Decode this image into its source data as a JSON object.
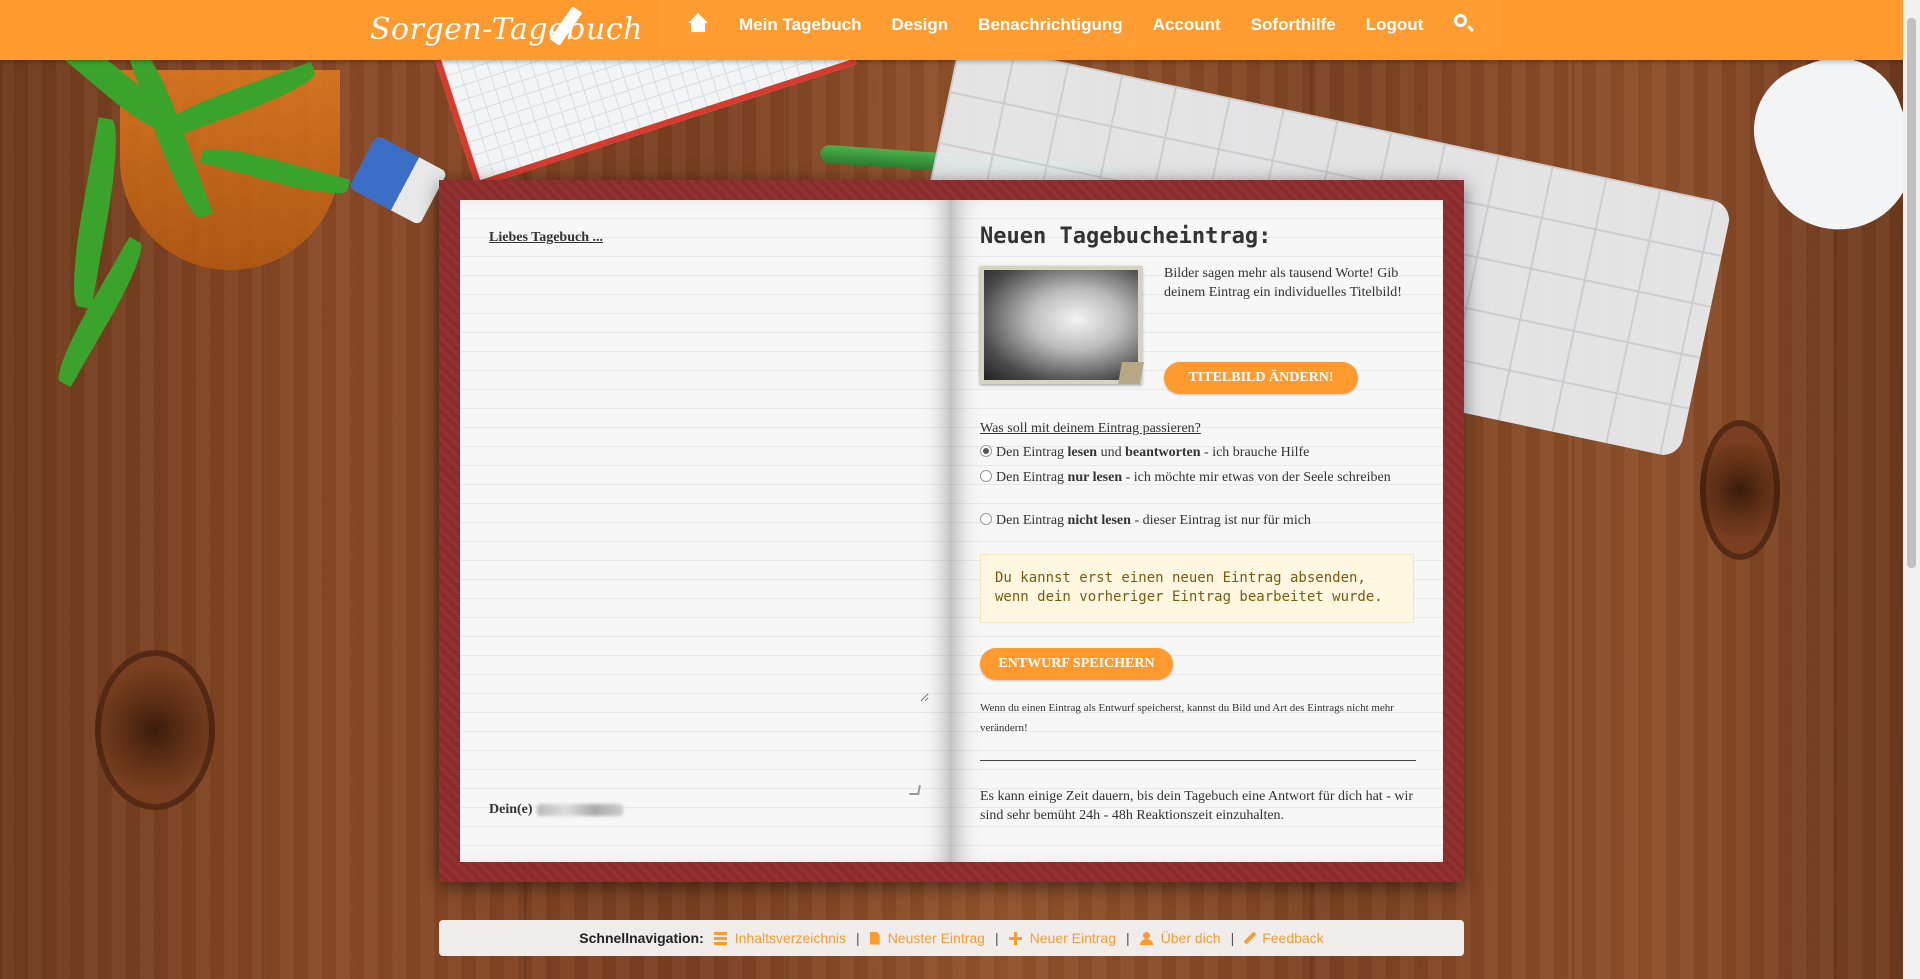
{
  "header": {
    "logo": "Sorgen-Tagebuch",
    "nav": {
      "home_icon": "home-icon",
      "items": [
        "Mein Tagebuch",
        "Design",
        "Benachrichtigung",
        "Account",
        "Soforthilfe",
        "Logout"
      ],
      "search_icon": "search-icon"
    }
  },
  "left_page": {
    "greeting": "Liebes Tagebuch ...",
    "textarea_value": "",
    "signature_prefix": "Dein(e)"
  },
  "right_page": {
    "title": "Neuen Tagebucheintrag:",
    "image_text": "Bilder sagen mehr als tausend Worte! Gib deinem Eintrag ein individuelles Titelbild!",
    "cover_button": "TITELBILD ÄNDERN!",
    "question": "Was soll mit deinem Eintrag passieren?",
    "options": [
      {
        "pre": "Den Eintrag ",
        "b1": "lesen",
        "mid": " und ",
        "b2": "beantworten",
        "post": " - ich brauche Hilfe",
        "checked": true
      },
      {
        "pre": "Den Eintrag ",
        "b1": "nur lesen",
        "post": " - ich möchte mir etwas von der Seele schreiben",
        "checked": false
      },
      {
        "pre": "Den Eintrag ",
        "b1": "nicht lesen",
        "post": " - dieser Eintrag ist nur für mich",
        "checked": false
      }
    ],
    "notice": "Du kannst erst einen neuen Eintrag absenden, wenn dein vorheriger Eintrag bearbeitet wurde.",
    "draft_button": "ENTWURF SPEICHERN",
    "draft_note": "Wenn du einen Eintrag als Entwurf speicherst, kannst du Bild und Art des Eintrags nicht mehr verändern!",
    "wait_note": "Es kann einige Zeit dauern, bis dein Tagebuch eine Antwort für dich hat - wir sind sehr bemüht 24h - 48h Reaktionszeit einzuhalten."
  },
  "quicknav": {
    "label": "Schnellnavigation:",
    "links": [
      {
        "label": "Inhaltsverzeichnis",
        "icon": "list-icon"
      },
      {
        "label": "Neuster Eintrag",
        "icon": "file-icon"
      },
      {
        "label": "Neuer Eintrag",
        "icon": "plus-icon"
      },
      {
        "label": "Über dich",
        "icon": "user-icon"
      },
      {
        "label": "Feedback",
        "icon": "pencil-icon"
      }
    ]
  },
  "colors": {
    "accent": "#ff9a2e",
    "book_cover": "#8b2a2a",
    "notice_bg": "#fff7e0"
  }
}
